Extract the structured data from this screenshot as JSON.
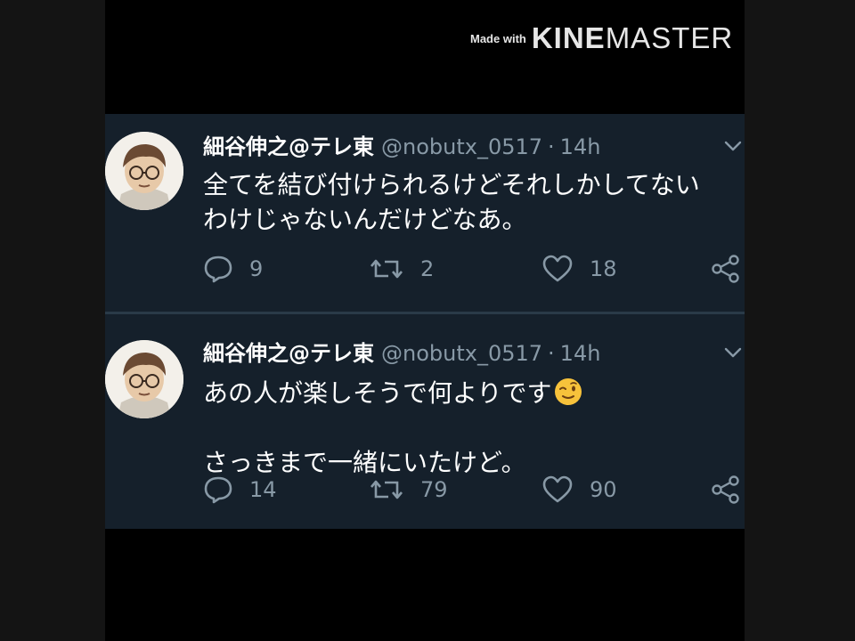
{
  "watermark": {
    "made_with": "Made with",
    "kine": "KINE",
    "master": "MASTER"
  },
  "tweets": [
    {
      "name": "細谷伸之@テレ東",
      "handle": "@nobutx_0517",
      "separator": "·",
      "time": "14h",
      "text": "全てを結び付けられるけどそれしかしてない\nわけじゃないんだけどなあ。",
      "emoji": "",
      "replies": "9",
      "retweets": "2",
      "likes": "18"
    },
    {
      "name": "細谷伸之@テレ東",
      "handle": "@nobutx_0517",
      "separator": "·",
      "time": "14h",
      "text": "あの人が楽しそうで何よりです",
      "text2": "\n\nさっきまで一緒にいたけど。",
      "emoji": "winking-face-emoji",
      "replies": "14",
      "retweets": "79",
      "likes": "90"
    }
  ],
  "colors": {
    "background": "#15202b",
    "secondary_text": "#8899a6",
    "primary_text": "#ffffff",
    "divider": "#2a3a48"
  },
  "icons": {
    "reply": "reply-bubble-icon",
    "retweet": "retweet-arrows-icon",
    "like": "heart-icon",
    "share": "share-icon",
    "menu": "chevron-down-icon"
  }
}
